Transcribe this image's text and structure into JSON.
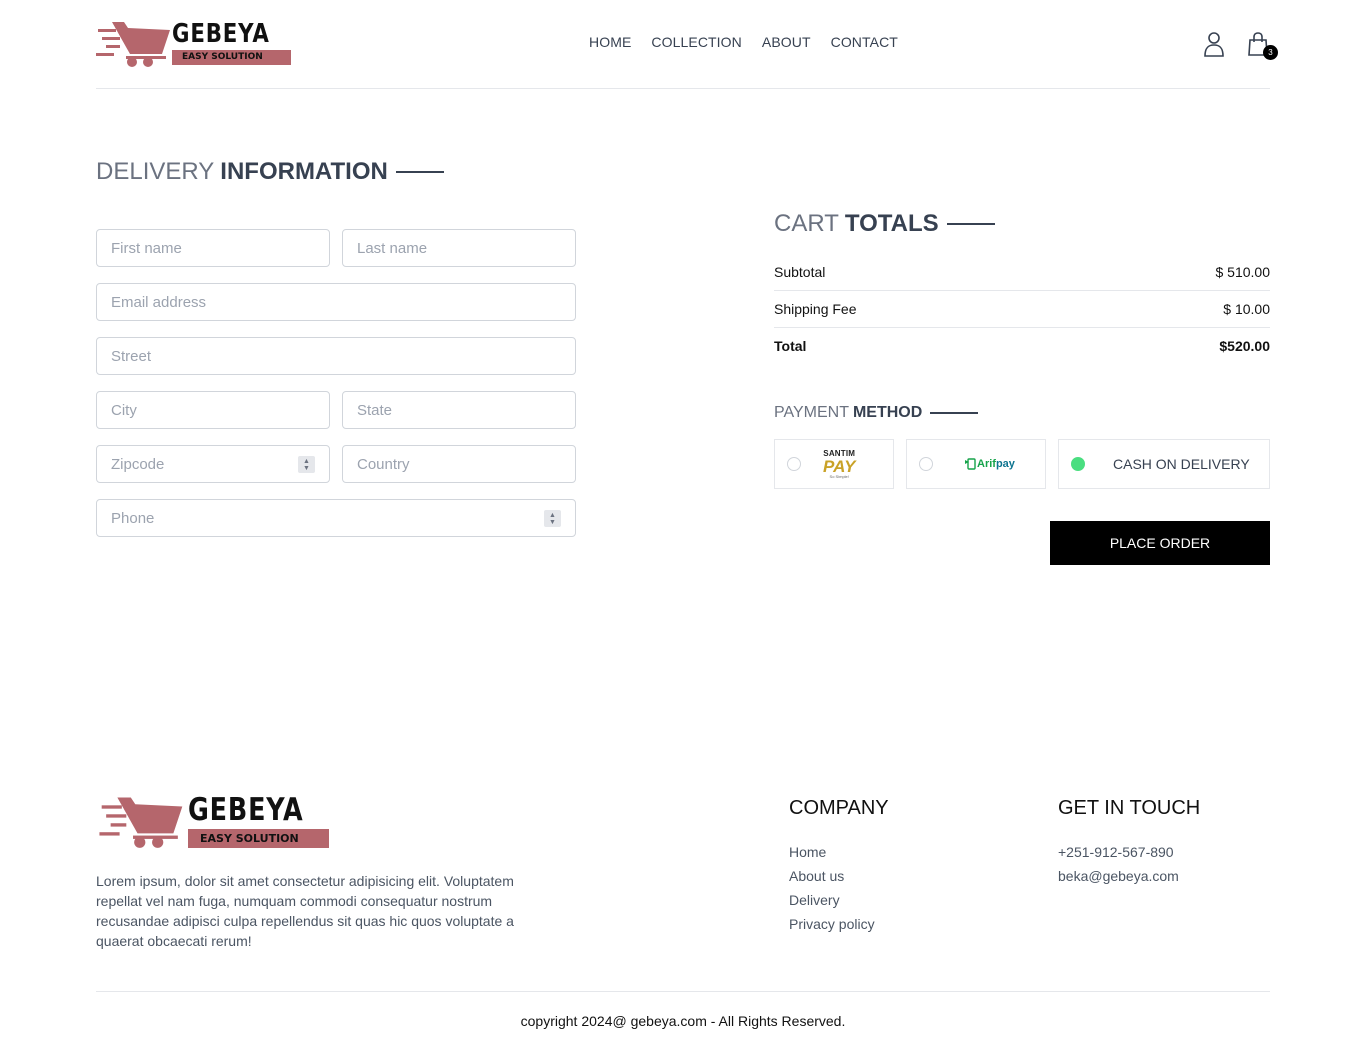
{
  "brand": {
    "name": "GEBEYA",
    "tagline": "EASY SOLUTION",
    "color": "#b5666c"
  },
  "nav": {
    "items": [
      "HOME",
      "COLLECTION",
      "ABOUT",
      "CONTACT"
    ]
  },
  "header_icons": {
    "profile": "profile-icon",
    "cart": "cart-icon",
    "cart_count": "3"
  },
  "delivery": {
    "title_light": "DELIVERY",
    "title_bold": "INFORMATION",
    "fields": {
      "first_name": "First name",
      "last_name": "Last name",
      "email": "Email address",
      "street": "Street",
      "city": "City",
      "state": "State",
      "zipcode": "Zipcode",
      "country": "Country",
      "phone": "Phone"
    }
  },
  "cart_totals": {
    "title_light": "CART",
    "title_bold": "TOTALS",
    "subtotal_label": "Subtotal",
    "subtotal_value": "$ 510.00",
    "shipping_label": "Shipping Fee",
    "shipping_value": "$ 10.00",
    "total_label": "Total",
    "total_value": "$520.00"
  },
  "payment": {
    "title_light": "PAYMENT",
    "title_bold": "METHOD",
    "santim": {
      "top": "SANTIM",
      "main": "PAY",
      "sub": "So Simple!"
    },
    "arif": {
      "a": "Arif",
      "b": "pay"
    },
    "cod_label": "CASH ON DELIVERY",
    "selected": "cod",
    "selected_color": "#4ade80"
  },
  "place_order": "PLACE ORDER",
  "footer": {
    "description": "Lorem ipsum, dolor sit amet consectetur adipisicing elit. Voluptatem repellat vel nam fuga, numquam commodi consequatur nostrum recusandae adipisci culpa repellendus sit quas hic quos voluptate a quaerat obcaecati rerum!",
    "company_title": "COMPANY",
    "company_links": [
      "Home",
      "About us",
      "Delivery",
      "Privacy policy"
    ],
    "contact_title": "GET IN TOUCH",
    "phone": "+251-912-567-890",
    "email": "beka@gebeya.com",
    "copyright": "copyright 2024@ gebeya.com - All Rights Reserved."
  }
}
